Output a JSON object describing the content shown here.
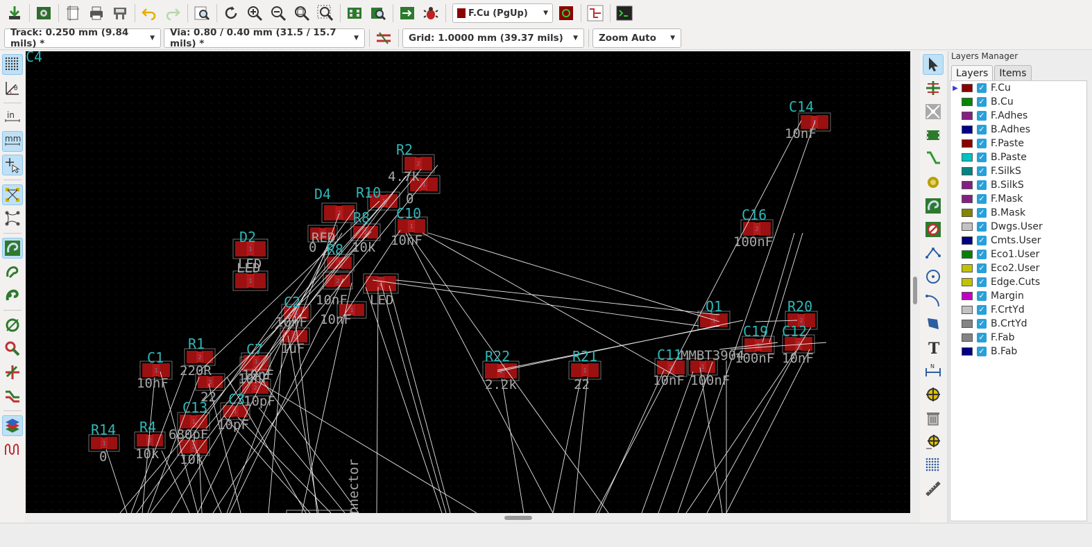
{
  "toolbar_top": {
    "buttons": [
      {
        "name": "save-board-icon"
      },
      {
        "name": "board-setup-icon"
      },
      {
        "name": "page-settings-icon"
      },
      {
        "name": "print-icon"
      },
      {
        "name": "plot-icon"
      },
      {
        "name": "undo-icon"
      },
      {
        "name": "redo-icon"
      },
      {
        "name": "find-icon"
      },
      {
        "name": "redraw-icon"
      },
      {
        "name": "zoom-in-icon"
      },
      {
        "name": "zoom-out-icon"
      },
      {
        "name": "zoom-fit-icon"
      },
      {
        "name": "zoom-selection-icon"
      },
      {
        "name": "footprint-editor-icon"
      },
      {
        "name": "footprint-viewer-icon"
      },
      {
        "name": "netlist-import-icon"
      },
      {
        "name": "drc-icon"
      }
    ],
    "layer_select": {
      "label": "F.Cu (PgUp)",
      "color": "#8b0000"
    }
  },
  "toolbar_second": {
    "track": "Track: 0.250 mm (9.84 mils) *",
    "via": "Via: 0.80 / 0.40 mm (31.5 / 15.7 mils) *",
    "grid": "Grid: 1.0000 mm (39.37 mils)",
    "zoom": "Zoom Auto"
  },
  "left_toolbar": [
    {
      "name": "grid-toggle-icon",
      "active": true
    },
    {
      "name": "polar-coords-icon",
      "active": false
    },
    {
      "name": "units-inch-icon",
      "active": false,
      "text": "in"
    },
    {
      "name": "units-mm-icon",
      "active": true,
      "text": "mm"
    },
    {
      "name": "cursor-shape-icon",
      "active": true
    },
    {
      "name": "show-ratsnest-icon",
      "active": true
    },
    {
      "name": "curved-ratsnest-icon",
      "active": false
    },
    {
      "name": "show-zones-icon",
      "active": true
    },
    {
      "name": "zone-outline-icon",
      "active": false
    },
    {
      "name": "zone-fill-icon",
      "active": false
    },
    {
      "name": "pad-sketch-icon",
      "active": false
    },
    {
      "name": "via-sketch-icon",
      "active": false
    },
    {
      "name": "track-sketch-icon",
      "active": false
    },
    {
      "name": "high-contrast-icon",
      "active": false
    },
    {
      "name": "layers-manager-toggle-icon",
      "active": true
    },
    {
      "name": "microwave-toolbar-icon",
      "active": false
    }
  ],
  "right_toolbar": [
    {
      "name": "select-arrow-icon",
      "active": true
    },
    {
      "name": "highlight-net-icon",
      "active": false
    },
    {
      "name": "local-ratsnest-icon",
      "active": false
    },
    {
      "name": "add-footprint-icon",
      "active": false
    },
    {
      "name": "route-track-icon",
      "active": false
    },
    {
      "name": "add-via-icon",
      "active": false
    },
    {
      "name": "add-zone-icon",
      "active": false
    },
    {
      "name": "keepout-area-icon",
      "active": false
    },
    {
      "name": "draw-line-icon",
      "active": false
    },
    {
      "name": "draw-circle-icon",
      "active": false
    },
    {
      "name": "draw-arc-icon",
      "active": false
    },
    {
      "name": "draw-polygon-icon",
      "active": false
    },
    {
      "name": "add-text-icon",
      "active": false
    },
    {
      "name": "add-dimension-icon",
      "active": false
    },
    {
      "name": "add-target-icon",
      "active": false
    },
    {
      "name": "delete-icon",
      "active": false
    },
    {
      "name": "place-origin-icon",
      "active": false
    },
    {
      "name": "grid-origin-icon",
      "active": false
    },
    {
      "name": "measure-icon",
      "active": false
    }
  ],
  "layers_manager": {
    "title": "Layers Manager",
    "tabs": [
      "Layers",
      "Items"
    ],
    "layers": [
      {
        "name": "F.Cu",
        "color": "#8b0000",
        "current": true
      },
      {
        "name": "B.Cu",
        "color": "#008800"
      },
      {
        "name": "F.Adhes",
        "color": "#842084"
      },
      {
        "name": "B.Adhes",
        "color": "#000084"
      },
      {
        "name": "F.Paste",
        "color": "#8b0000"
      },
      {
        "name": "B.Paste",
        "color": "#00c2c2"
      },
      {
        "name": "F.SilkS",
        "color": "#008484"
      },
      {
        "name": "B.SilkS",
        "color": "#842084"
      },
      {
        "name": "F.Mask",
        "color": "#842084"
      },
      {
        "name": "B.Mask",
        "color": "#848400"
      },
      {
        "name": "Dwgs.User",
        "color": "#c2c2c2"
      },
      {
        "name": "Cmts.User",
        "color": "#000084"
      },
      {
        "name": "Eco1.User",
        "color": "#008400"
      },
      {
        "name": "Eco2.User",
        "color": "#c2c200"
      },
      {
        "name": "Edge.Cuts",
        "color": "#c2c200"
      },
      {
        "name": "Margin",
        "color": "#c200c2"
      },
      {
        "name": "F.CrtYd",
        "color": "#c2c2c2"
      },
      {
        "name": "B.CrtYd",
        "color": "#848484"
      },
      {
        "name": "F.Fab",
        "color": "#848484"
      },
      {
        "name": "B.Fab",
        "color": "#000084"
      }
    ]
  },
  "board": {
    "components": [
      {
        "ref": "C14",
        "value": "10nF"
      },
      {
        "ref": "R2",
        "value": "4.7k"
      },
      {
        "ref": "",
        "value": "0"
      },
      {
        "ref": "D4",
        "value": "RED"
      },
      {
        "ref": "R10",
        "value": ""
      },
      {
        "ref": "R8",
        "value": "10k"
      },
      {
        "ref": "C10",
        "value": "10nF"
      },
      {
        "ref": "C16",
        "value": "100nF"
      },
      {
        "ref": "D2",
        "value": "LED"
      },
      {
        "ref": "",
        "value": "0"
      },
      {
        "ref": "R8",
        "value": ""
      },
      {
        "ref": "C4",
        "value": "10nF"
      },
      {
        "ref": "",
        "value": "LED"
      },
      {
        "ref": "",
        "value": "LED"
      },
      {
        "ref": "Q1",
        "value": "MMBT3904"
      },
      {
        "ref": "R20",
        "value": ""
      },
      {
        "ref": "C2",
        "value": "10nF"
      },
      {
        "ref": "",
        "value": "1uF"
      },
      {
        "ref": "",
        "value": "10nF"
      },
      {
        "ref": "",
        "value": "10nF"
      },
      {
        "ref": "C19",
        "value": "100nF"
      },
      {
        "ref": "C12",
        "value": "10nF"
      },
      {
        "ref": "C1",
        "value": "10nF"
      },
      {
        "ref": "R1",
        "value": "220R"
      },
      {
        "ref": "C7",
        "value": "10nF"
      },
      {
        "ref": "R22",
        "value": "2.2k"
      },
      {
        "ref": "R21",
        "value": "22"
      },
      {
        "ref": "C11",
        "value": "10nF"
      },
      {
        "ref": "",
        "value": "100nF"
      },
      {
        "ref": "",
        "value": "22"
      },
      {
        "ref": "C3",
        "value": "10pF"
      },
      {
        "ref": "",
        "value": "10pF"
      },
      {
        "ref": "R14",
        "value": "0"
      },
      {
        "ref": "R4",
        "value": "10k"
      },
      {
        "ref": "C13",
        "value": "680pF"
      },
      {
        "ref": "",
        "value": "10k"
      }
    ],
    "connector_label": "nnector"
  }
}
